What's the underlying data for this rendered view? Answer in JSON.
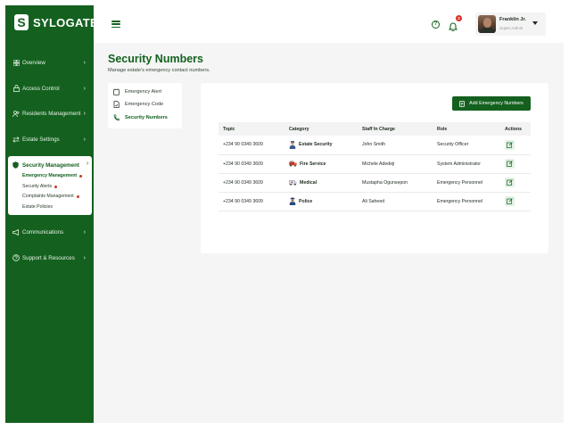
{
  "brand": {
    "name": "SYLOGATE",
    "mark": "S"
  },
  "sidebar": {
    "items": [
      {
        "label": "Overview",
        "icon": "grid-icon"
      },
      {
        "label": "Access Control",
        "icon": "lock-icon"
      },
      {
        "label": "Residents Management",
        "icon": "users-icon"
      },
      {
        "label": "Estate Settings",
        "icon": "swap-icon"
      },
      {
        "label": "Security Management",
        "icon": "shield-icon"
      },
      {
        "label": "Communications",
        "icon": "megaphone-icon"
      },
      {
        "label": "Support & Resources",
        "icon": "help-circle-icon"
      }
    ],
    "security_sub": [
      {
        "label": "Emergency Management",
        "dot": true
      },
      {
        "label": "Security Alerts",
        "dot": true
      },
      {
        "label": "Complaints Management",
        "dot": true
      },
      {
        "label": "Estate Policies",
        "dot": false
      }
    ]
  },
  "topbar": {
    "notification_count": "2",
    "user": {
      "name": "Franklin Jr.",
      "role": "Super Admin"
    }
  },
  "page": {
    "title": "Security Numbers",
    "subtitle": "Manage estate's emergency contact numbers."
  },
  "subnav": {
    "items": [
      {
        "label": "Emergency Alert",
        "icon": "alert-icon"
      },
      {
        "label": "Emergency Code",
        "icon": "code-icon"
      },
      {
        "label": "Security Numbers",
        "icon": "phone-icon",
        "active": true
      }
    ]
  },
  "toolbar": {
    "add_label": "Add Emergency Numbers"
  },
  "table": {
    "columns": [
      "Topic",
      "Category",
      "Staff In Charge",
      "Role",
      "Actions"
    ],
    "rows": [
      {
        "topic": "+234 90 0349 3609",
        "category": "Estate Security",
        "category_icon": "guard-icon",
        "staff": "John Smith",
        "role": "Security Officer"
      },
      {
        "topic": "+234 90 0349 3609",
        "category": "Fire Service",
        "category_icon": "fire-truck-icon",
        "staff": "Michele Adedeji",
        "role": "System Administrator"
      },
      {
        "topic": "+234 90 0349 3609",
        "category": "Medical",
        "category_icon": "ambulance-icon",
        "staff": "Mustapha Ogunsepon",
        "role": "Emergency Personnel"
      },
      {
        "topic": "+234 90 0349 3609",
        "category": "Police",
        "category_icon": "police-icon",
        "staff": "Ali Saheed",
        "role": "Emergency Personnel"
      }
    ]
  },
  "colors": {
    "brand_green": "#14611f",
    "badge_red": "#d93025",
    "edit_bg": "#e3f2e4"
  }
}
